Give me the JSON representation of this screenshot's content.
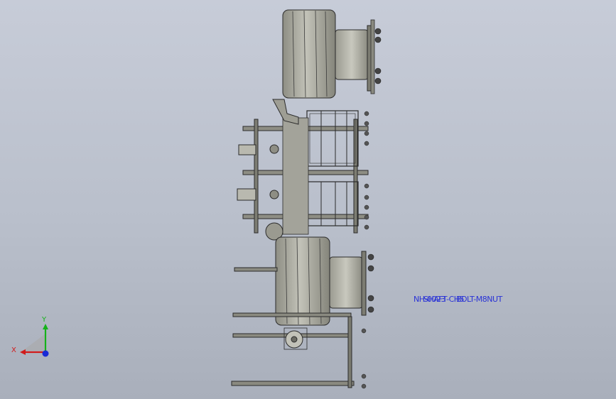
{
  "annotation": {
    "layers": [
      "NH-0023",
      "SHAFT-CH5",
      "BOLT-M8NUT"
    ]
  },
  "triad": {
    "x_label": "X",
    "y_label": "Y",
    "colors": {
      "x": "#d11b1b",
      "y": "#15b21a",
      "z": "#1a2bd6"
    }
  },
  "colors": {
    "background_top": "#c7ccd8",
    "background_bottom": "#a9afbb",
    "model_gray": "#9a9a8e",
    "edge_line": "#2b2b2b"
  }
}
